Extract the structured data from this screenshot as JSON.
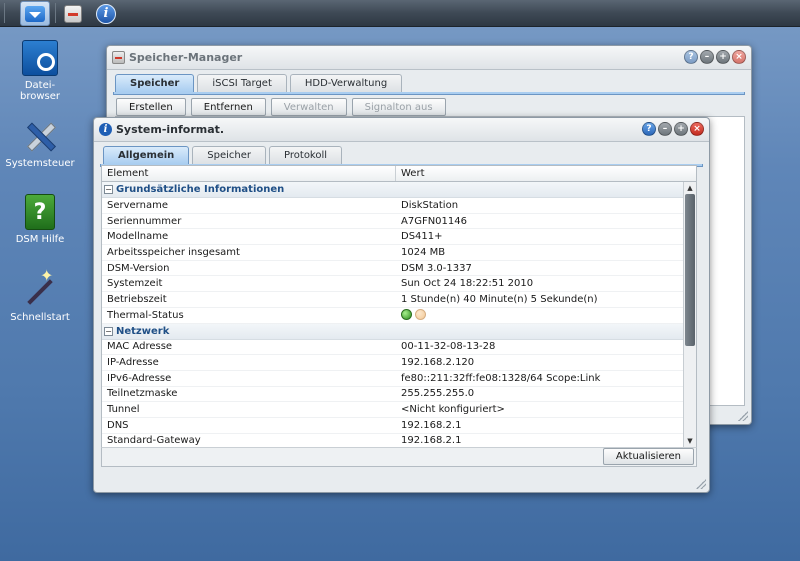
{
  "taskbar": {
    "buttons": [
      {
        "name": "main-menu",
        "icon": "main-menu-icon"
      },
      {
        "name": "storage-manager",
        "icon": "storage-manager-icon"
      },
      {
        "name": "system-info",
        "icon": "info-icon"
      }
    ]
  },
  "desktop": {
    "icons": [
      {
        "label": "Datei-\nbrowser",
        "icon": "file-browser-icon"
      },
      {
        "label": "Systemsteuer",
        "icon": "control-panel-icon"
      },
      {
        "label": "DSM Hilfe",
        "icon": "help-icon",
        "glyph": "?"
      },
      {
        "label": "Schnellstart",
        "icon": "quick-start-icon"
      }
    ]
  },
  "storage_window": {
    "title": "Speicher-Manager",
    "tabs": [
      "Speicher",
      "iSCSI Target",
      "HDD-Verwaltung"
    ],
    "active_tab": "Speicher",
    "buttons": [
      {
        "label": "Erstellen",
        "enabled": true
      },
      {
        "label": "Entfernen",
        "enabled": true
      },
      {
        "label": "Verwalten",
        "enabled": false
      },
      {
        "label": "Signalton aus",
        "enabled": false
      }
    ]
  },
  "sysinfo_window": {
    "title": "System-informat.",
    "tabs": [
      "Allgemein",
      "Speicher",
      "Protokoll"
    ],
    "active_tab": "Allgemein",
    "columns": {
      "element": "Element",
      "value": "Wert"
    },
    "groups": [
      {
        "title": "Grundsätzliche Informationen",
        "rows": [
          {
            "k": "Servername",
            "v": "DiskStation"
          },
          {
            "k": "Seriennummer",
            "v": "A7GFN01146"
          },
          {
            "k": "Modellname",
            "v": "DS411+"
          },
          {
            "k": "Arbeitsspeicher insgesamt",
            "v": "1024 MB"
          },
          {
            "k": "DSM-Version",
            "v": "DSM 3.0-1337"
          },
          {
            "k": "Systemzeit",
            "v": "Sun Oct 24 18:22:51 2010"
          },
          {
            "k": "Betriebszeit",
            "v": "1 Stunde(n) 40 Minute(n) 5 Sekunde(n)"
          },
          {
            "k": "Thermal-Status",
            "v": "",
            "status": [
              "green",
              "orange"
            ]
          }
        ]
      },
      {
        "title": "Netzwerk",
        "rows": [
          {
            "k": "MAC Adresse",
            "v": "00-11-32-08-13-28"
          },
          {
            "k": "IP-Adresse",
            "v": "192.168.2.120"
          },
          {
            "k": "IPv6-Adresse",
            "v": "fe80::211:32ff:fe08:1328/64 Scope:Link"
          },
          {
            "k": "Teilnetzmaske",
            "v": "255.255.255.0"
          },
          {
            "k": "Tunnel",
            "v": "<Nicht konfiguriert>"
          },
          {
            "k": "DNS",
            "v": "192.168.2.1"
          },
          {
            "k": "Standard-Gateway",
            "v": "192.168.2.1"
          }
        ]
      }
    ],
    "refresh_button": "Aktualisieren"
  },
  "colors": {
    "accent": "#1f5fb5",
    "close": "#c22b1f",
    "status_ok": "#2c8c1d",
    "status_warn": "#f0b672"
  }
}
